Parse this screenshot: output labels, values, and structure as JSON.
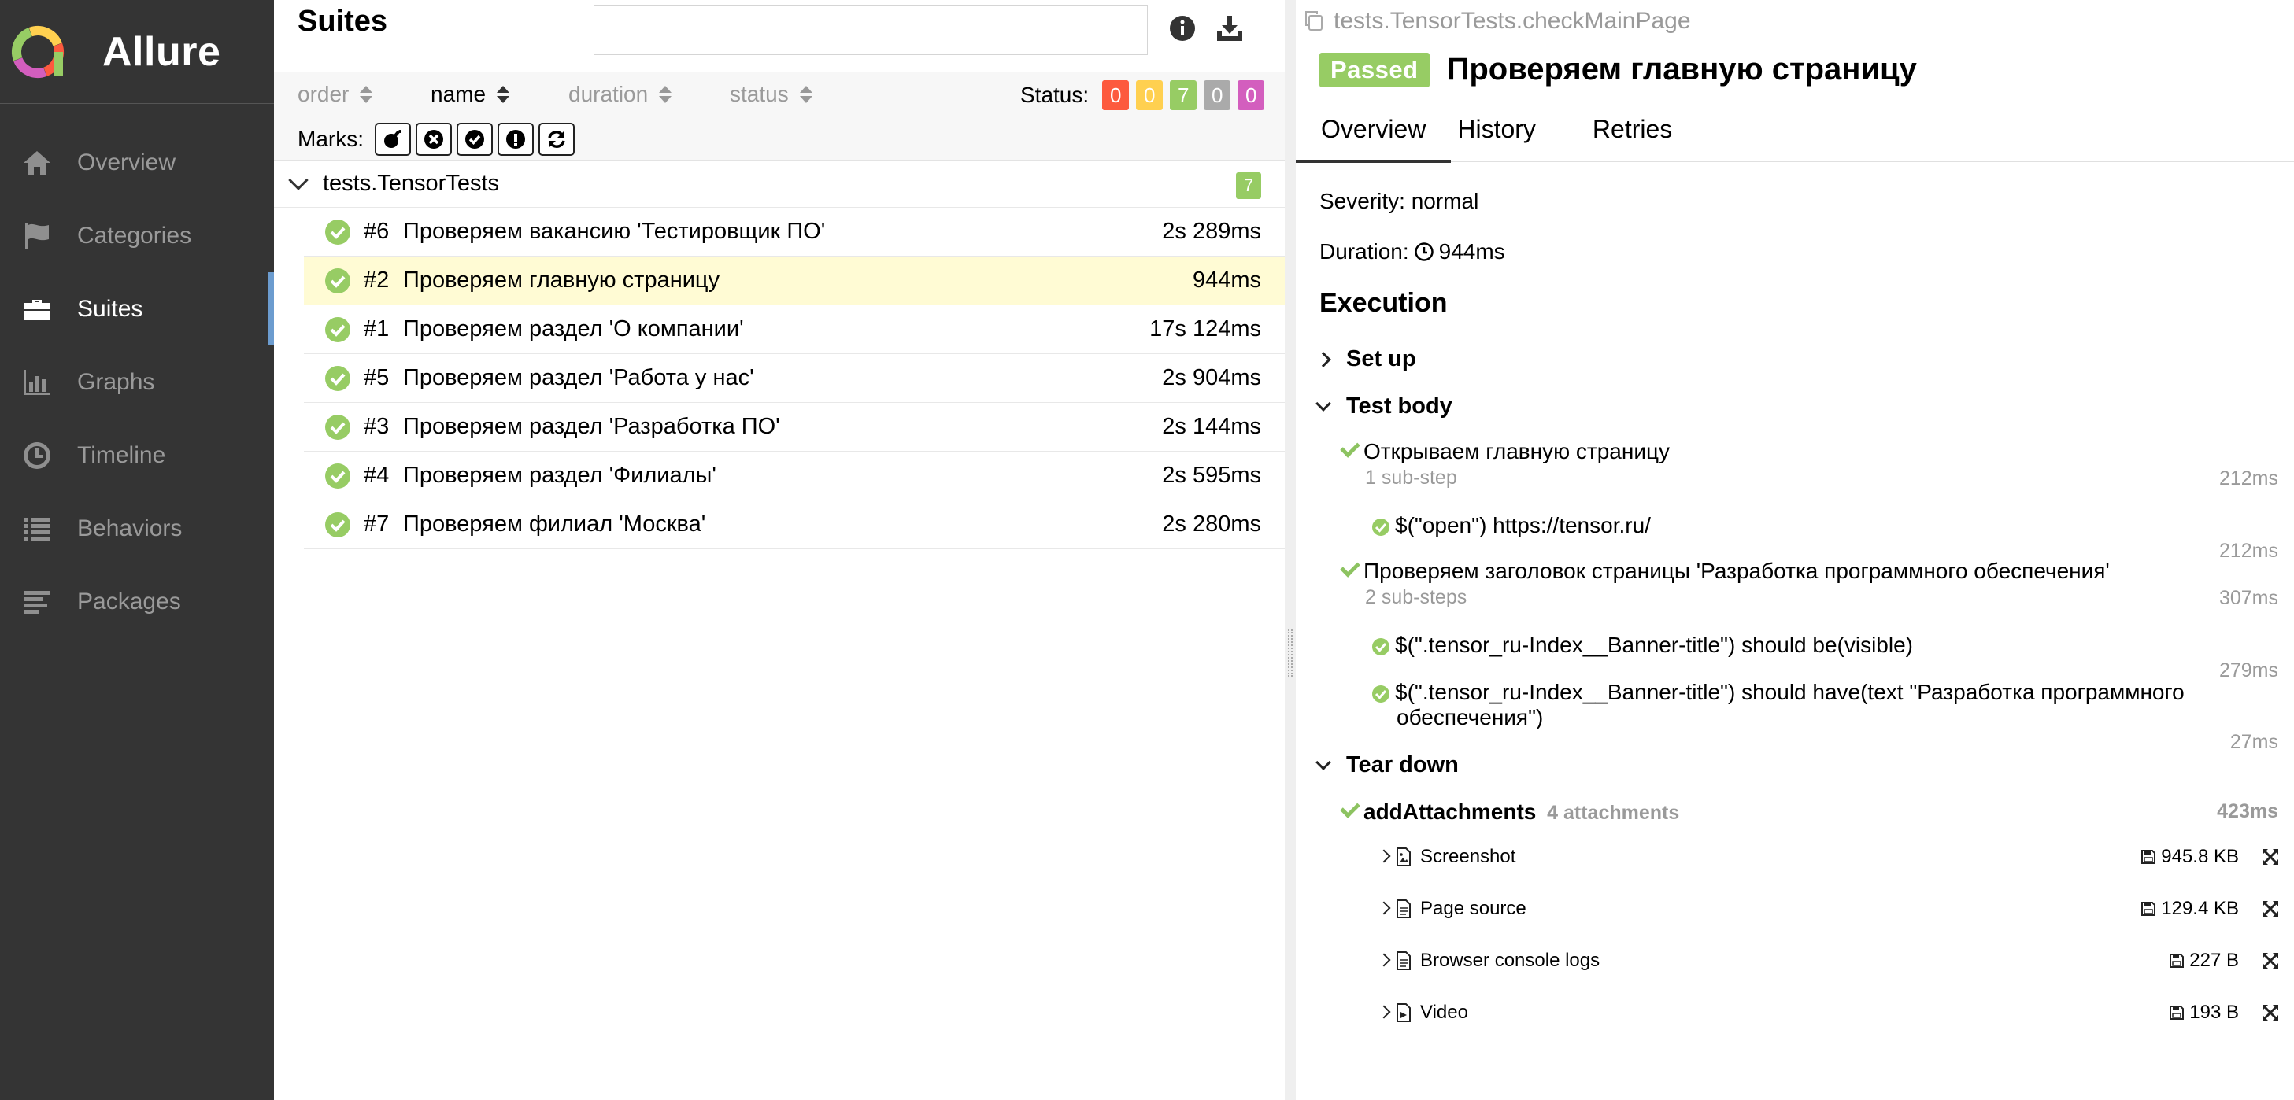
{
  "brand": {
    "name": "Allure"
  },
  "sidebar": {
    "items": [
      {
        "label": "Overview",
        "icon": "home-icon"
      },
      {
        "label": "Categories",
        "icon": "flag-icon"
      },
      {
        "label": "Suites",
        "icon": "briefcase-icon",
        "active": true
      },
      {
        "label": "Graphs",
        "icon": "bar-chart-icon"
      },
      {
        "label": "Timeline",
        "icon": "clock-icon"
      },
      {
        "label": "Behaviors",
        "icon": "list-icon"
      },
      {
        "label": "Packages",
        "icon": "align-left-icon"
      }
    ]
  },
  "suites": {
    "title": "Suites",
    "search": {
      "value": "",
      "placeholder": ""
    },
    "sort": {
      "order": "order",
      "name": "name",
      "duration": "duration",
      "status": "status"
    },
    "status_label": "Status:",
    "status_counts": [
      {
        "value": "0",
        "color": "#fd5a3e",
        "status": "failed"
      },
      {
        "value": "0",
        "color": "#ffd050",
        "status": "broken"
      },
      {
        "value": "7",
        "color": "#97cc64",
        "status": "passed"
      },
      {
        "value": "0",
        "color": "#aaaaaa",
        "status": "skipped"
      },
      {
        "value": "0",
        "color": "#d35ebe",
        "status": "unknown"
      }
    ],
    "marks_label": "Marks:",
    "group": {
      "name": "tests.TensorTests",
      "count": "7"
    },
    "tests": [
      {
        "num": "#6",
        "name": "Проверяем вакансию 'Тестировщик ПО'",
        "duration": "2s 289ms"
      },
      {
        "num": "#2",
        "name": "Проверяем главную страницу",
        "duration": "944ms",
        "selected": true
      },
      {
        "num": "#1",
        "name": "Проверяем раздел 'О компании'",
        "duration": "17s 124ms"
      },
      {
        "num": "#5",
        "name": "Проверяем раздел 'Работа у нас'",
        "duration": "2s 904ms"
      },
      {
        "num": "#3",
        "name": "Проверяем раздел 'Разработка ПО'",
        "duration": "2s 144ms"
      },
      {
        "num": "#4",
        "name": "Проверяем раздел 'Филиалы'",
        "duration": "2s 595ms"
      },
      {
        "num": "#7",
        "name": "Проверяем филиал 'Москва'",
        "duration": "2s 280ms"
      }
    ]
  },
  "details": {
    "breadcrumb": "tests.TensorTests.checkMainPage",
    "status_badge": "Passed",
    "title": "Проверяем главную страницу",
    "tabs": [
      "Overview",
      "History",
      "Retries"
    ],
    "severity": "Severity: normal",
    "duration_label": "Duration:",
    "duration_value": "944ms",
    "execution_heading": "Execution",
    "setup_label": "Set up",
    "test_body_label": "Test body",
    "steps": [
      {
        "name": "Открываем главную страницу",
        "substeps": "1 sub-step",
        "time": "212ms"
      },
      {
        "name": "$(\"open\") https://tensor.ru/",
        "time": "212ms"
      },
      {
        "name": "Проверяем заголовок страницы 'Разработка программного обеспечения'",
        "substeps": "2 sub-steps",
        "time": "307ms"
      },
      {
        "name": "$(\".tensor_ru-Index__Banner-title\") should be(visible)",
        "time": "279ms"
      },
      {
        "name_line1": "$(\".tensor_ru-Index__Banner-title\") should have(text \"Разработка программного",
        "name_line2": "обеспечения\")",
        "time": "27ms"
      }
    ],
    "teardown_label": "Tear down",
    "teardown_step": {
      "name": "addAttachments",
      "attachments": "4 attachments",
      "time": "423ms"
    },
    "attachments": [
      {
        "name": "Screenshot",
        "size": "945.8 KB",
        "icon": "image-file-icon"
      },
      {
        "name": "Page source",
        "size": "129.4 KB",
        "icon": "text-file-icon"
      },
      {
        "name": "Browser console logs",
        "size": "227 B",
        "icon": "text-file-icon"
      },
      {
        "name": "Video",
        "size": "193 B",
        "icon": "video-file-icon"
      }
    ]
  }
}
